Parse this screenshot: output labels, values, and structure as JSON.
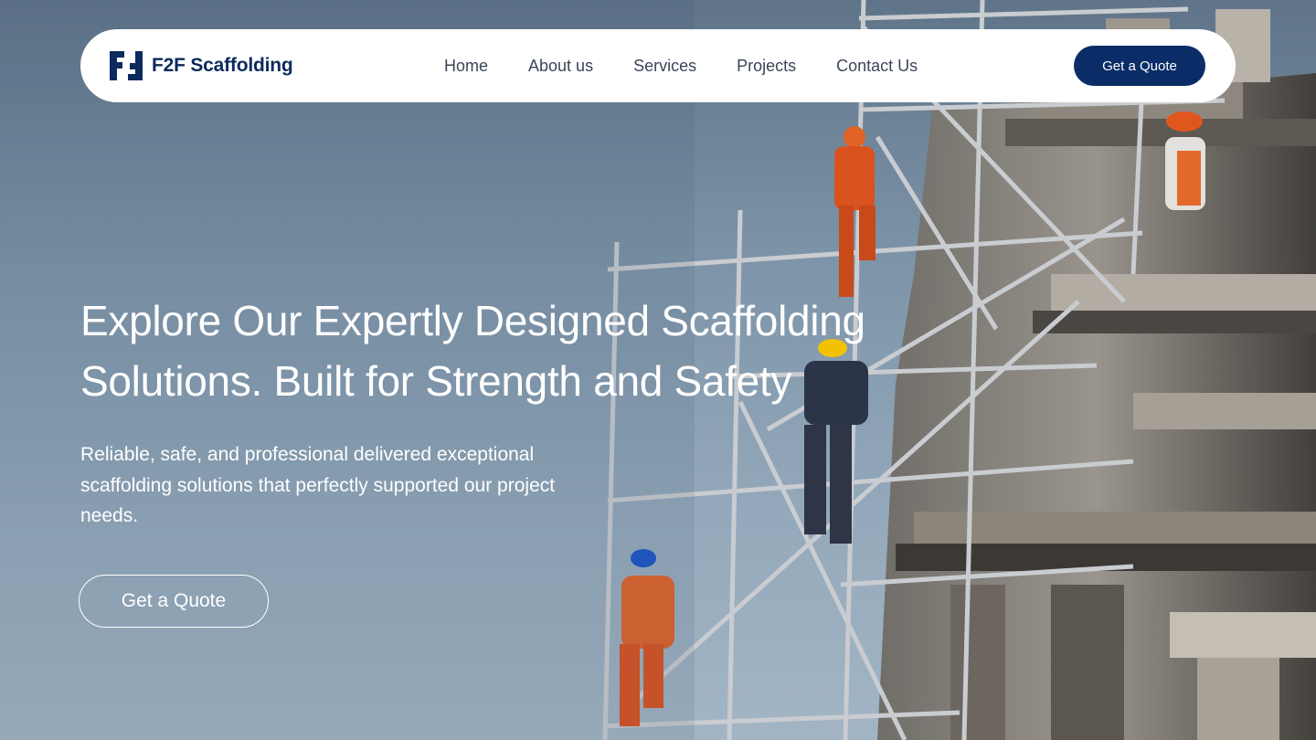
{
  "brand": {
    "name": "F2F Scaffolding",
    "logo_icon": "f2f-logo-icon"
  },
  "nav": {
    "links": [
      "Home",
      "About us",
      "Services",
      "Projects",
      "Contact Us"
    ],
    "cta_label": "Get a Quote"
  },
  "hero": {
    "headline_line1": "Explore Our Expertly Designed Scaffolding",
    "headline_line2": "Solutions. Built for Strength and Safety",
    "subtext": "Reliable, safe, and professional delivered exceptional scaffolding solutions that perfectly supported our project needs.",
    "cta_label": "Get a Quote"
  },
  "colors": {
    "brand_navy": "#0b2d67",
    "nav_text": "#3a4556",
    "sky": "#7d94a8",
    "worker_orange": "#d9531f"
  }
}
